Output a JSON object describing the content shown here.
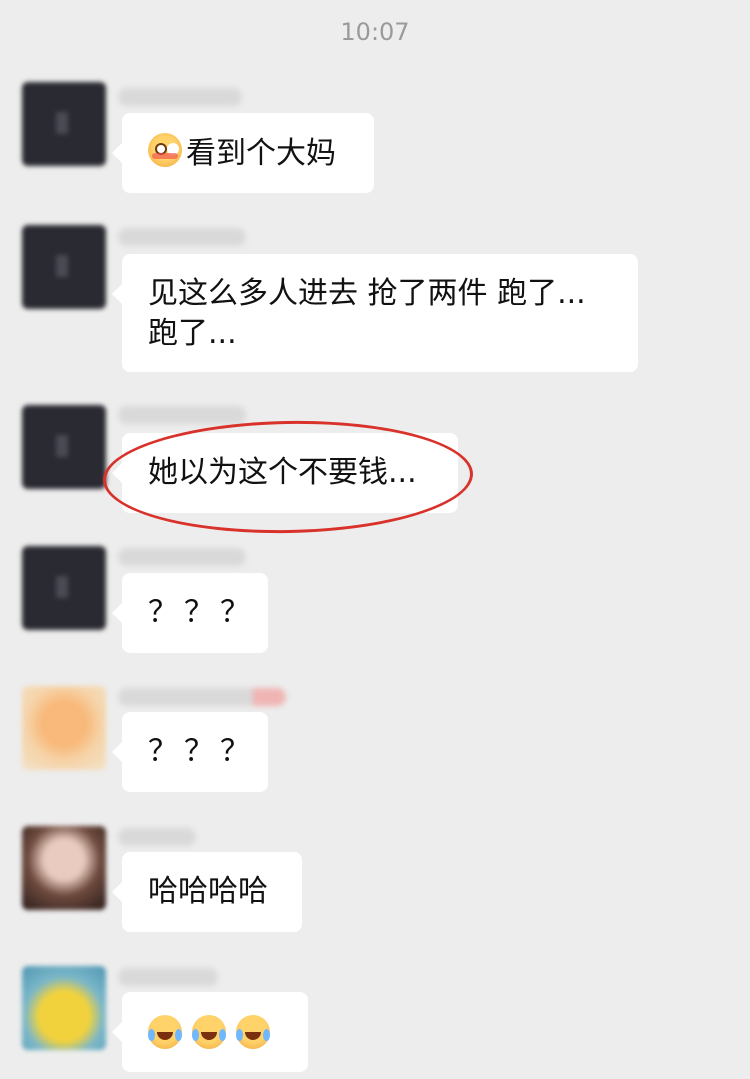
{
  "chat": {
    "timestamp": "10:07",
    "messages": [
      {
        "avatar": "blurred-dark-avatar",
        "text_after_emoji": "看到个大妈",
        "emoji": "flushed-face"
      },
      {
        "avatar": "blurred-dark-avatar",
        "lines": [
          "见这么多人进去 抢了两件 跑了...",
          "跑了..."
        ]
      },
      {
        "avatar": "blurred-dark-avatar",
        "text": "她以为这个不要钱...",
        "highlighted": true
      },
      {
        "avatar": "blurred-dark-avatar",
        "text": "？？？"
      },
      {
        "avatar": "blurred-peach-avatar",
        "text": "？？？"
      },
      {
        "avatar": "blurred-photo-avatar",
        "text": "哈哈哈哈"
      },
      {
        "avatar": "blurred-yellow-avatar",
        "emojis": [
          "face-with-tears-of-joy",
          "face-with-tears-of-joy",
          "face-with-tears-of-joy"
        ]
      }
    ]
  },
  "colors": {
    "background": "#ededed",
    "bubble": "#ffffff",
    "highlight_circle": "#d8322a"
  }
}
